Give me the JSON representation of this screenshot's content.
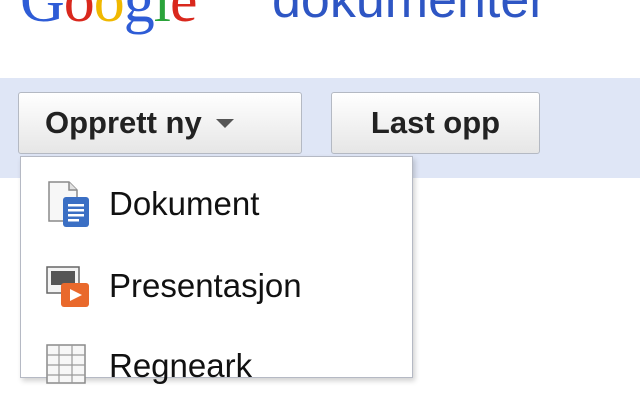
{
  "header": {
    "logo_letters": [
      "G",
      "o",
      "o",
      "g",
      "l",
      "e"
    ],
    "product": "dokumenter"
  },
  "toolbar": {
    "create_label": "Opprett ny",
    "upload_label": "Last opp"
  },
  "menu": {
    "items": [
      {
        "label": "Dokument",
        "icon": "document-icon"
      },
      {
        "label": "Presentasjon",
        "icon": "presentation-icon"
      },
      {
        "label": "Regneark",
        "icon": "spreadsheet-icon"
      }
    ]
  },
  "colors": {
    "toolbar_bg": "#dfe6f6",
    "product_blue": "#2e56c4"
  }
}
